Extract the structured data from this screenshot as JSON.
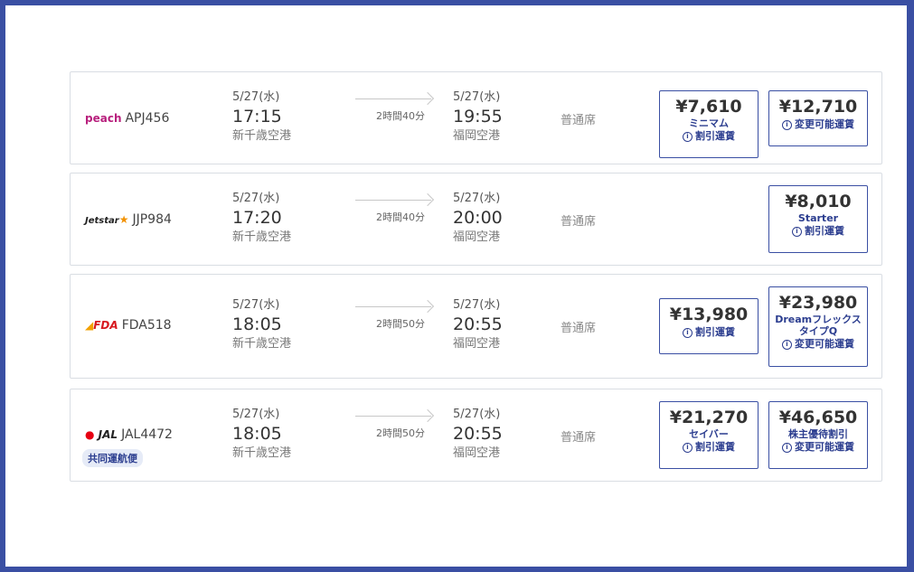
{
  "flights": [
    {
      "airline_logo": "peach",
      "flight_no": "APJ456",
      "dep": {
        "date": "5/27(水)",
        "time": "17:15",
        "airport": "新千歳空港"
      },
      "duration": "2時間40分",
      "arr": {
        "date": "5/27(水)",
        "time": "19:55",
        "airport": "福岡空港"
      },
      "seat_class": "普通席",
      "fares": [
        {
          "price": "¥7,610",
          "name": "ミニマム",
          "type": "割引運賃"
        },
        {
          "price": "¥12,710",
          "type": "変更可能運賃"
        }
      ]
    },
    {
      "airline_logo": "Jetstar",
      "flight_no": "JJP984",
      "dep": {
        "date": "5/27(水)",
        "time": "17:20",
        "airport": "新千歳空港"
      },
      "duration": "2時間40分",
      "arr": {
        "date": "5/27(水)",
        "time": "20:00",
        "airport": "福岡空港"
      },
      "seat_class": "普通席",
      "fares": [
        {
          "price": "¥8,010",
          "name": "Starter",
          "type": "割引運賃"
        }
      ]
    },
    {
      "airline_logo": "FDA",
      "flight_no": "FDA518",
      "dep": {
        "date": "5/27(水)",
        "time": "18:05",
        "airport": "新千歳空港"
      },
      "duration": "2時間50分",
      "arr": {
        "date": "5/27(水)",
        "time": "20:55",
        "airport": "福岡空港"
      },
      "seat_class": "普通席",
      "fares": [
        {
          "price": "¥13,980",
          "type": "割引運賃"
        },
        {
          "price": "¥23,980",
          "name": "Dreamフレックス",
          "name2": "タイプQ",
          "type": "変更可能運賃"
        }
      ]
    },
    {
      "airline_logo": "JAL",
      "flight_no": "JAL4472",
      "codeshare": "共同運航便",
      "dep": {
        "date": "5/27(水)",
        "time": "18:05",
        "airport": "新千歳空港"
      },
      "duration": "2時間50分",
      "arr": {
        "date": "5/27(水)",
        "time": "20:55",
        "airport": "福岡空港"
      },
      "seat_class": "普通席",
      "fares": [
        {
          "price": "¥21,270",
          "name": "セイバー",
          "type": "割引運賃"
        },
        {
          "price": "¥46,650",
          "name": "株主優待割引",
          "type": "変更可能運賃"
        }
      ]
    }
  ],
  "icons": {
    "info": "info-circle-icon",
    "arrow": "arrow-right-icon"
  },
  "colors": {
    "frame": "#3a4fa3",
    "accent": "#2b3d8f",
    "peach": "#b8207d",
    "jal_red": "#e60012",
    "fda_red": "#d71920"
  }
}
